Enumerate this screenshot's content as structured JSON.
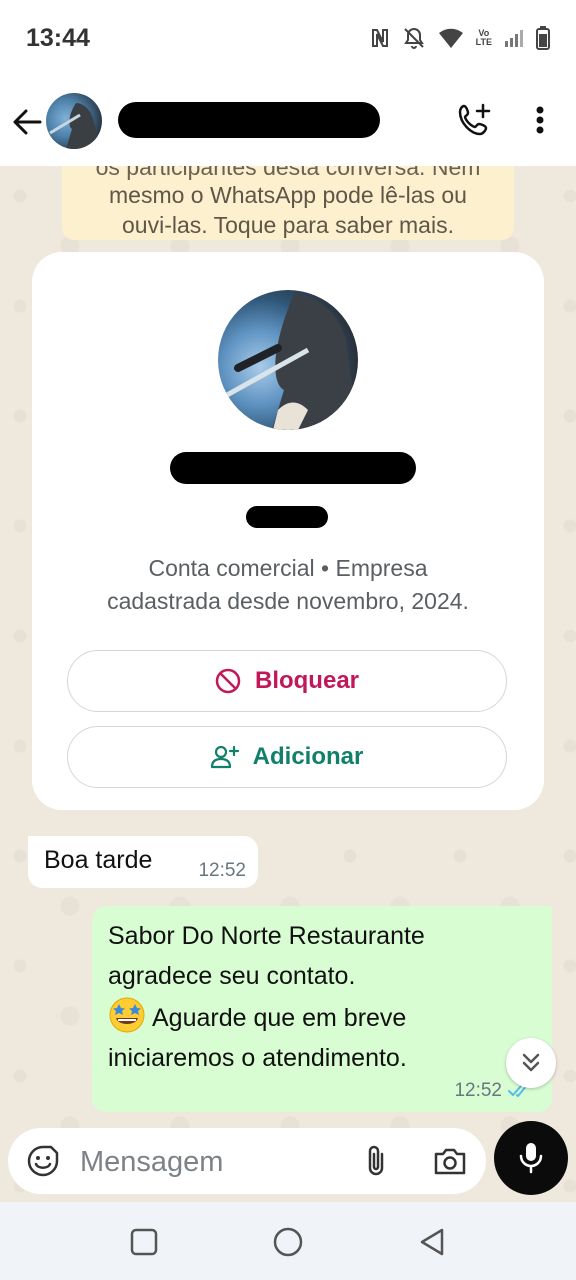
{
  "status_bar": {
    "time": "13:44",
    "icons": [
      "nfc-icon",
      "mute-icon",
      "wifi-icon",
      "volte-icon",
      "signal-icon",
      "battery-icon"
    ],
    "volte_top": "Vo",
    "volte_bottom": "LTE"
  },
  "header": {
    "contact_name_redacted": true,
    "icons": [
      "back-arrow-icon",
      "add-call-icon",
      "more-vert-icon"
    ]
  },
  "encryption_notice": {
    "line_cut": "os participantes desta conversa. Nem",
    "line2": "mesmo o WhatsApp pode lê-las ou",
    "line3": "ouvi-las. Toque para saber mais."
  },
  "business_card": {
    "info_line1": "Conta comercial • Empresa",
    "info_line2": "cadastrada desde novembro, 2024.",
    "block_label": "Bloquear",
    "add_label": "Adicionar",
    "colors": {
      "block": "#c0185a",
      "add": "#11806a"
    }
  },
  "messages": {
    "incoming": {
      "text": "Boa tarde",
      "time": "12:52"
    },
    "outgoing": {
      "line1": "Sabor Do Norte Restaurante",
      "line2": "agradece seu contato.",
      "line3": "Aguarde que em breve",
      "line4": "iniciaremos o atendimento.",
      "emoji": "star-struck-emoji",
      "time": "12:52",
      "status": "read"
    }
  },
  "input_bar": {
    "placeholder": "Mensagem",
    "icons": [
      "emoji-icon",
      "attach-icon",
      "camera-icon",
      "mic-icon"
    ]
  },
  "nav_bar": {
    "icons": [
      "recent-apps-icon",
      "home-icon",
      "nav-back-icon"
    ]
  },
  "colors": {
    "chat_background": "#efe8dd",
    "outgoing_bubble": "#d9fdd3",
    "notice_background": "#fdf0cf",
    "read_ticks": "#53bdeb"
  }
}
